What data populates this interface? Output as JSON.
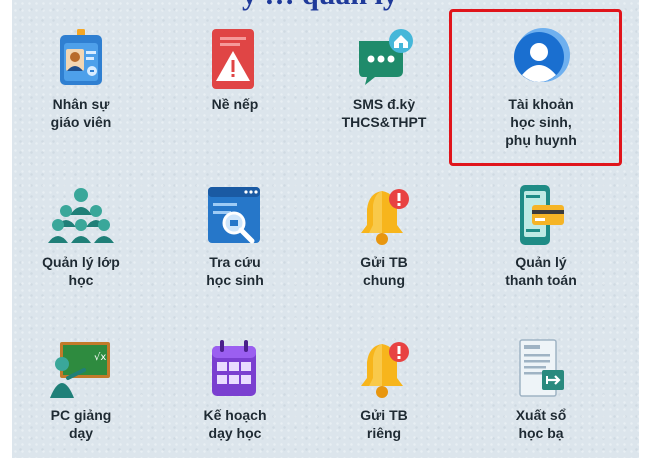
{
  "header": {
    "title_fragment": "y … quản lý"
  },
  "tiles": [
    {
      "id": "nhan-su",
      "lines": [
        "Nhân sự",
        "giáo viên"
      ],
      "icon": "teacher-id-card-icon"
    },
    {
      "id": "ne-nep",
      "lines": [
        "Nề nếp"
      ],
      "icon": "warning-clipboard-icon"
    },
    {
      "id": "sms",
      "lines": [
        "SMS đ.kỳ",
        "THCS&THPT"
      ],
      "icon": "sms-chat-icon"
    },
    {
      "id": "tai-khoan",
      "lines": [
        "Tài khoản",
        "học sinh,",
        "phụ huynh"
      ],
      "icon": "user-account-icon",
      "highlighted": true
    },
    {
      "id": "quan-ly-lop",
      "lines": [
        "Quản lý lớp",
        "học"
      ],
      "icon": "class-group-icon"
    },
    {
      "id": "tra-cuu",
      "lines": [
        "Tra cứu",
        "học sinh"
      ],
      "icon": "student-search-icon"
    },
    {
      "id": "gui-tb-chung",
      "lines": [
        "Gửi TB",
        "chung"
      ],
      "icon": "bell-notification-icon"
    },
    {
      "id": "thanh-toan",
      "lines": [
        "Quản lý",
        "thanh toán"
      ],
      "icon": "payment-phone-icon"
    },
    {
      "id": "pc-giang-day",
      "lines": [
        "PC giảng",
        "dạy"
      ],
      "icon": "blackboard-teacher-icon"
    },
    {
      "id": "ke-hoach",
      "lines": [
        "Kế hoạch",
        "dạy học"
      ],
      "icon": "calendar-plan-icon"
    },
    {
      "id": "gui-tb-rieng",
      "lines": [
        "Gửi TB",
        "riêng"
      ],
      "icon": "bell-notification-icon"
    },
    {
      "id": "xuat-so",
      "lines": [
        "Xuất sổ",
        "học bạ"
      ],
      "icon": "report-book-export-icon"
    }
  ],
  "colors": {
    "highlight": "#e0141b",
    "title": "#1f3a9a",
    "background": "#dce5ec"
  }
}
